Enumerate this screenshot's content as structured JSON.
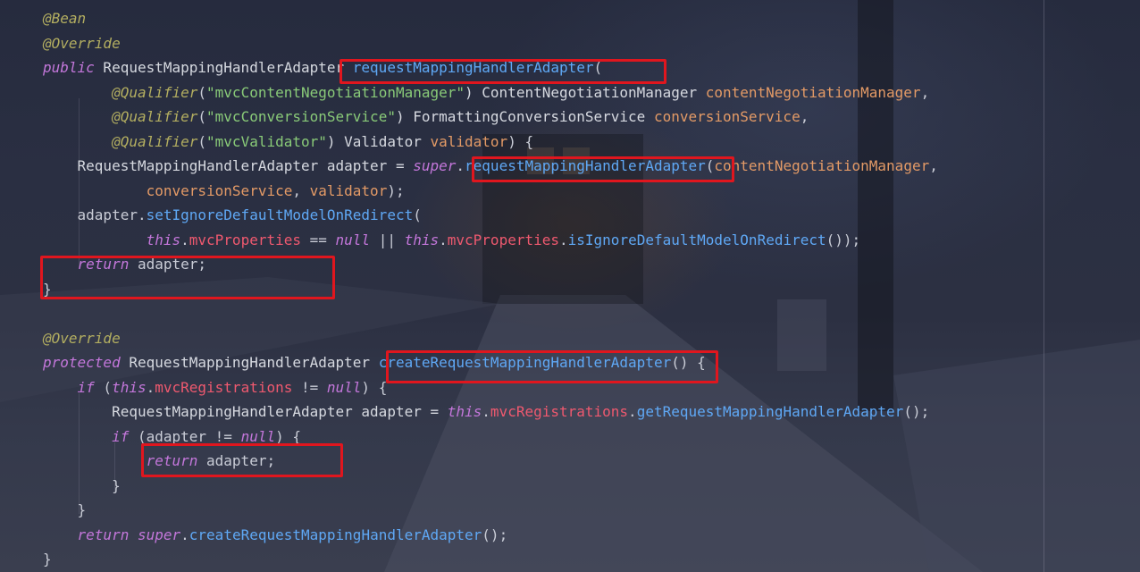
{
  "editor": {
    "lines": [
      [
        {
          "text": "@Bean",
          "cls": "t-annotation"
        }
      ],
      [
        {
          "text": "@Override",
          "cls": "t-annotation"
        }
      ],
      [
        {
          "text": "public",
          "cls": "t-keyword"
        },
        {
          "text": " RequestMappingHandlerAdapter ",
          "cls": "t-type"
        },
        {
          "text": "requestMappingHandlerAdapter",
          "cls": "t-method"
        },
        {
          "text": "(",
          "cls": "t-plain"
        }
      ],
      [
        {
          "text": "        ",
          "cls": "t-plain"
        },
        {
          "text": "@Qualifier",
          "cls": "t-annotation"
        },
        {
          "text": "(",
          "cls": "t-plain"
        },
        {
          "text": "\"mvcContentNegotiationManager\"",
          "cls": "t-string"
        },
        {
          "text": ") ContentNegotiationManager ",
          "cls": "t-type"
        },
        {
          "text": "contentNegotiationManager",
          "cls": "t-param"
        },
        {
          "text": ",",
          "cls": "t-plain"
        }
      ],
      [
        {
          "text": "        ",
          "cls": "t-plain"
        },
        {
          "text": "@Qualifier",
          "cls": "t-annotation"
        },
        {
          "text": "(",
          "cls": "t-plain"
        },
        {
          "text": "\"mvcConversionService\"",
          "cls": "t-string"
        },
        {
          "text": ") FormattingConversionService ",
          "cls": "t-type"
        },
        {
          "text": "conversionService",
          "cls": "t-param"
        },
        {
          "text": ",",
          "cls": "t-plain"
        }
      ],
      [
        {
          "text": "        ",
          "cls": "t-plain"
        },
        {
          "text": "@Qualifier",
          "cls": "t-annotation"
        },
        {
          "text": "(",
          "cls": "t-plain"
        },
        {
          "text": "\"mvcValidator\"",
          "cls": "t-string"
        },
        {
          "text": ") Validator ",
          "cls": "t-type"
        },
        {
          "text": "validator",
          "cls": "t-param"
        },
        {
          "text": ") {",
          "cls": "t-plain"
        }
      ],
      [
        {
          "text": "    RequestMappingHandlerAdapter adapter = ",
          "cls": "t-type"
        },
        {
          "text": "super",
          "cls": "t-keyword"
        },
        {
          "text": ".",
          "cls": "t-plain"
        },
        {
          "text": "requestMappingHandlerAdapter",
          "cls": "t-method"
        },
        {
          "text": "(",
          "cls": "t-plain"
        },
        {
          "text": "contentNegotiationManager",
          "cls": "t-param"
        },
        {
          "text": ",",
          "cls": "t-plain"
        }
      ],
      [
        {
          "text": "            ",
          "cls": "t-plain"
        },
        {
          "text": "conversionService",
          "cls": "t-param"
        },
        {
          "text": ", ",
          "cls": "t-plain"
        },
        {
          "text": "validator",
          "cls": "t-param"
        },
        {
          "text": ");",
          "cls": "t-plain"
        }
      ],
      [
        {
          "text": "    adapter.",
          "cls": "t-plain"
        },
        {
          "text": "setIgnoreDefaultModelOnRedirect",
          "cls": "t-method"
        },
        {
          "text": "(",
          "cls": "t-plain"
        }
      ],
      [
        {
          "text": "            ",
          "cls": "t-plain"
        },
        {
          "text": "this",
          "cls": "t-keyword"
        },
        {
          "text": ".",
          "cls": "t-plain"
        },
        {
          "text": "mvcProperties",
          "cls": "t-field"
        },
        {
          "text": " == ",
          "cls": "t-plain"
        },
        {
          "text": "null",
          "cls": "t-keyword"
        },
        {
          "text": " || ",
          "cls": "t-plain"
        },
        {
          "text": "this",
          "cls": "t-keyword"
        },
        {
          "text": ".",
          "cls": "t-plain"
        },
        {
          "text": "mvcProperties",
          "cls": "t-field"
        },
        {
          "text": ".",
          "cls": "t-plain"
        },
        {
          "text": "isIgnoreDefaultModelOnRedirect",
          "cls": "t-method"
        },
        {
          "text": "());",
          "cls": "t-plain"
        }
      ],
      [
        {
          "text": "    ",
          "cls": "t-plain"
        },
        {
          "text": "return",
          "cls": "t-keyword"
        },
        {
          "text": " adapter;",
          "cls": "t-plain"
        }
      ],
      [
        {
          "text": "}",
          "cls": "t-brace"
        }
      ],
      [
        {
          "text": "",
          "cls": "t-plain"
        }
      ],
      [
        {
          "text": "@Override",
          "cls": "t-annotation"
        }
      ],
      [
        {
          "text": "protected",
          "cls": "t-keyword"
        },
        {
          "text": " RequestMappingHandlerAdapter ",
          "cls": "t-type"
        },
        {
          "text": "createRequestMappingHandlerAdapter",
          "cls": "t-method"
        },
        {
          "text": "() {",
          "cls": "t-plain"
        }
      ],
      [
        {
          "text": "    ",
          "cls": "t-plain"
        },
        {
          "text": "if",
          "cls": "t-keyword"
        },
        {
          "text": " (",
          "cls": "t-plain"
        },
        {
          "text": "this",
          "cls": "t-keyword"
        },
        {
          "text": ".",
          "cls": "t-plain"
        },
        {
          "text": "mvcRegistrations",
          "cls": "t-field"
        },
        {
          "text": " != ",
          "cls": "t-plain"
        },
        {
          "text": "null",
          "cls": "t-keyword"
        },
        {
          "text": ") {",
          "cls": "t-plain"
        }
      ],
      [
        {
          "text": "        RequestMappingHandlerAdapter adapter = ",
          "cls": "t-type"
        },
        {
          "text": "this",
          "cls": "t-keyword"
        },
        {
          "text": ".",
          "cls": "t-plain"
        },
        {
          "text": "mvcRegistrations",
          "cls": "t-field"
        },
        {
          "text": ".",
          "cls": "t-plain"
        },
        {
          "text": "getRequestMappingHandlerAdapter",
          "cls": "t-method"
        },
        {
          "text": "();",
          "cls": "t-plain"
        }
      ],
      [
        {
          "text": "        ",
          "cls": "t-plain"
        },
        {
          "text": "if",
          "cls": "t-keyword"
        },
        {
          "text": " (adapter != ",
          "cls": "t-plain"
        },
        {
          "text": "null",
          "cls": "t-keyword"
        },
        {
          "text": ") {",
          "cls": "t-plain"
        }
      ],
      [
        {
          "text": "            ",
          "cls": "t-plain"
        },
        {
          "text": "return",
          "cls": "t-keyword"
        },
        {
          "text": " adapter;",
          "cls": "t-plain"
        }
      ],
      [
        {
          "text": "        }",
          "cls": "t-brace"
        }
      ],
      [
        {
          "text": "    }",
          "cls": "t-brace"
        }
      ],
      [
        {
          "text": "    ",
          "cls": "t-plain"
        },
        {
          "text": "return",
          "cls": "t-keyword"
        },
        {
          "text": " ",
          "cls": "t-plain"
        },
        {
          "text": "super",
          "cls": "t-keyword"
        },
        {
          "text": ".",
          "cls": "t-plain"
        },
        {
          "text": "createRequestMappingHandlerAdapter",
          "cls": "t-method"
        },
        {
          "text": "();",
          "cls": "t-plain"
        }
      ],
      [
        {
          "text": "}",
          "cls": "t-brace"
        }
      ]
    ]
  },
  "highlight_color": "#e0161e",
  "syntax_colors": {
    "annotation": "#b3ae60",
    "keyword": "#c477db",
    "method": "#5fa8f5",
    "string": "#89ca78",
    "parameter": "#e39a66",
    "field": "#ef596f",
    "plain": "#c9ccd6"
  }
}
